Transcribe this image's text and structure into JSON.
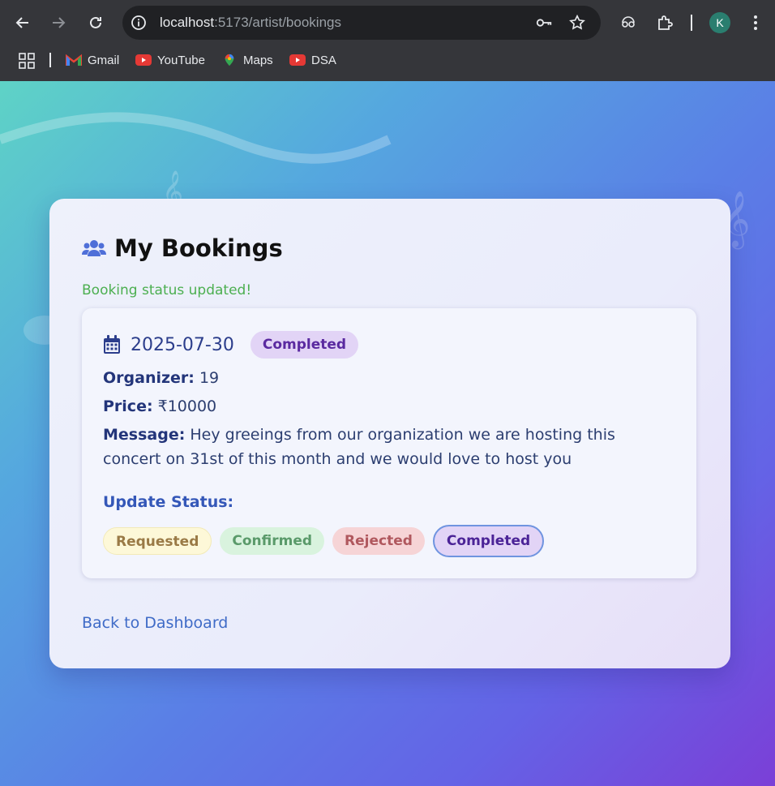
{
  "browser": {
    "url_host": "localhost",
    "url_path": ":5173/artist/bookings",
    "profile_initial": "K",
    "bookmarks": [
      {
        "label": "Gmail",
        "icon": "gmail-icon"
      },
      {
        "label": "YouTube",
        "icon": "youtube-icon"
      },
      {
        "label": "Maps",
        "icon": "maps-icon"
      },
      {
        "label": "DSA",
        "icon": "youtube-icon"
      }
    ]
  },
  "page": {
    "title": "My Bookings",
    "status_message": "Booking status updated!",
    "back_link": "Back to Dashboard"
  },
  "booking": {
    "date": "2025-07-30",
    "status": "Completed",
    "organizer_label": "Organizer:",
    "organizer_value": "19",
    "price_label": "Price:",
    "price_value": "₹10000",
    "message_label": "Message:",
    "message_value": "Hey greeings from our organization we are hosting this concert on 31st of this month and we would love to host you",
    "update_status_label": "Update Status:",
    "status_options": [
      "Requested",
      "Confirmed",
      "Rejected",
      "Completed"
    ]
  },
  "colors": {
    "status_success": "#4caf50",
    "accent_blue": "#3457b8",
    "completed_badge": "#e2d4f6"
  }
}
